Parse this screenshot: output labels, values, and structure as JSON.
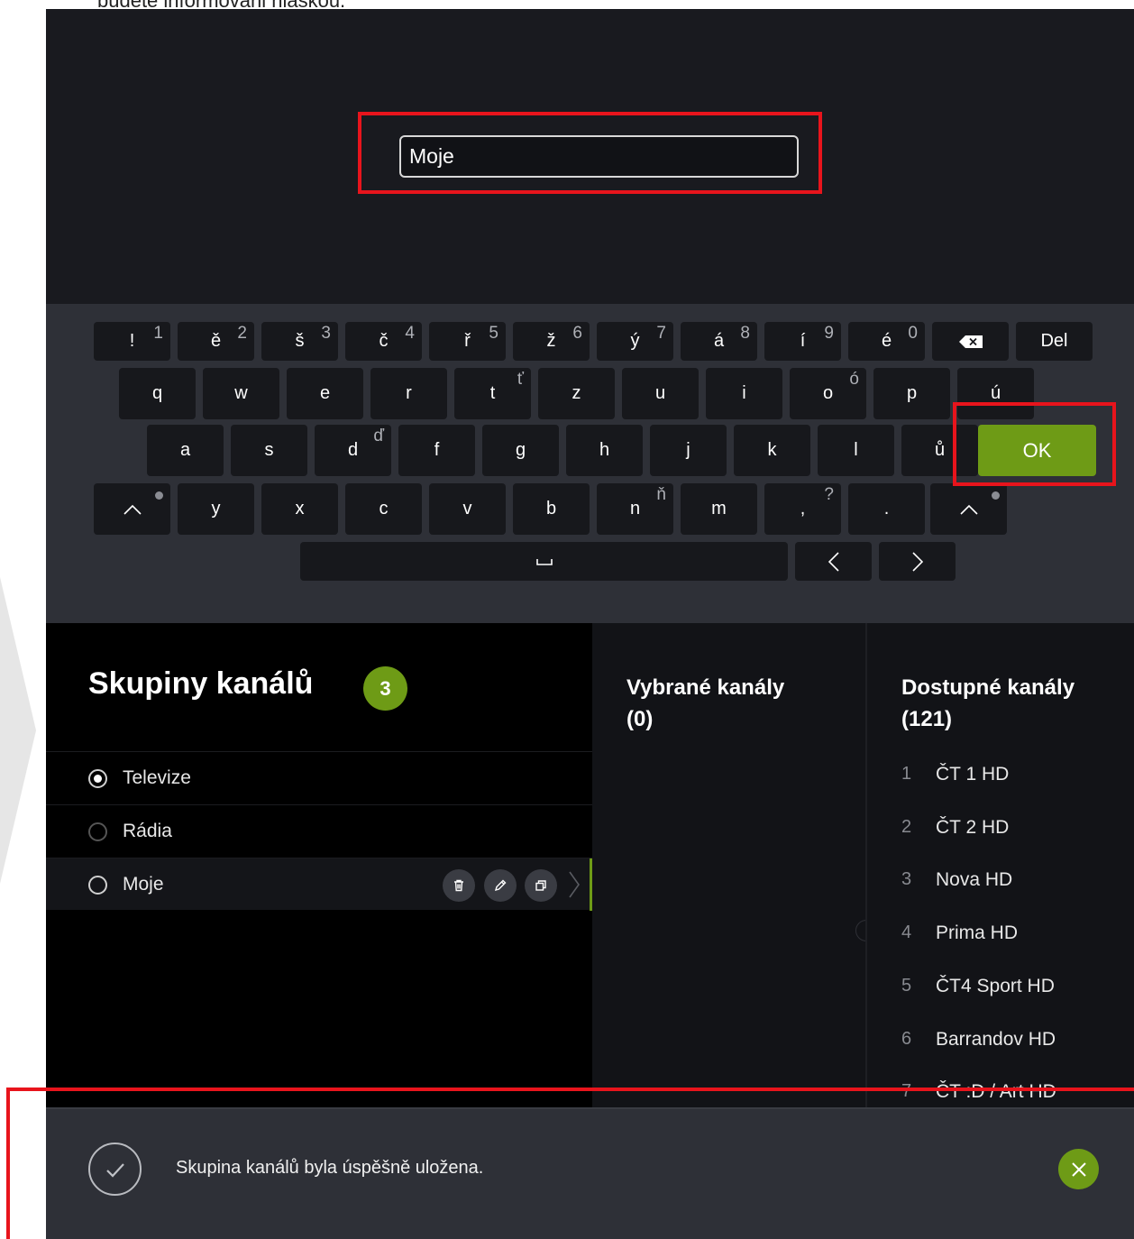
{
  "doc": {
    "text": "budete informováni hláškou."
  },
  "name_input": {
    "value": "Moje"
  },
  "keyboard": {
    "row1": [
      {
        "char": "!",
        "num": "1"
      },
      {
        "char": "ě",
        "num": "2"
      },
      {
        "char": "š",
        "num": "3"
      },
      {
        "char": "č",
        "num": "4"
      },
      {
        "char": "ř",
        "num": "5"
      },
      {
        "char": "ž",
        "num": "6"
      },
      {
        "char": "ý",
        "num": "7"
      },
      {
        "char": "á",
        "num": "8"
      },
      {
        "char": "í",
        "num": "9"
      },
      {
        "char": "é",
        "num": "0"
      }
    ],
    "backspace_icon": "backspace-icon",
    "del_label": "Del",
    "row2": [
      {
        "char": "q"
      },
      {
        "char": "w"
      },
      {
        "char": "e"
      },
      {
        "char": "r"
      },
      {
        "char": "t",
        "alt": "ť"
      },
      {
        "char": "z"
      },
      {
        "char": "u"
      },
      {
        "char": "i"
      },
      {
        "char": "o",
        "alt": "ó"
      },
      {
        "char": "p"
      },
      {
        "char": "ú"
      }
    ],
    "row3": [
      {
        "char": "a"
      },
      {
        "char": "s"
      },
      {
        "char": "d",
        "alt": "ď"
      },
      {
        "char": "f"
      },
      {
        "char": "g"
      },
      {
        "char": "h"
      },
      {
        "char": "j"
      },
      {
        "char": "k"
      },
      {
        "char": "l"
      },
      {
        "char": "ů"
      }
    ],
    "ok_label": "OK",
    "row4": [
      {
        "char": "y"
      },
      {
        "char": "x"
      },
      {
        "char": "c"
      },
      {
        "char": "v"
      },
      {
        "char": "b"
      },
      {
        "char": "n",
        "alt": "ň"
      },
      {
        "char": "m"
      },
      {
        "char": ",",
        "alt": "?"
      },
      {
        "char": "."
      }
    ],
    "space_icon": "space-icon",
    "shift_icon": "shift-icon"
  },
  "groups": {
    "title": "Skupiny kanálů",
    "count": "3",
    "items": [
      {
        "label": "Televize",
        "selected": true
      },
      {
        "label": "Rádia",
        "selected": false
      },
      {
        "label": "Moje",
        "selected": false,
        "active": true
      }
    ],
    "actions": [
      "trash-icon",
      "pencil-icon",
      "copy-icon"
    ]
  },
  "selected_channels": {
    "title": "Vybrané kanály",
    "count": "(0)"
  },
  "available_channels": {
    "title": "Dostupné kanály",
    "count": "(121)",
    "items": [
      {
        "num": "1",
        "name": "ČT 1 HD"
      },
      {
        "num": "2",
        "name": "ČT 2 HD"
      },
      {
        "num": "3",
        "name": "Nova HD"
      },
      {
        "num": "4",
        "name": "Prima HD"
      },
      {
        "num": "5",
        "name": "ČT4 Sport HD"
      },
      {
        "num": "6",
        "name": "Barrandov HD"
      },
      {
        "num": "7",
        "name": "ČT :D / Art HD"
      }
    ]
  },
  "toast": {
    "message": "Skupina kanálů byla úspěšně uložena.",
    "icon": "check-circle-icon",
    "close_icon": "close-icon"
  },
  "colors": {
    "accent": "#6e9b16",
    "highlight": "#e8141c",
    "background": "#0b0c0f"
  }
}
